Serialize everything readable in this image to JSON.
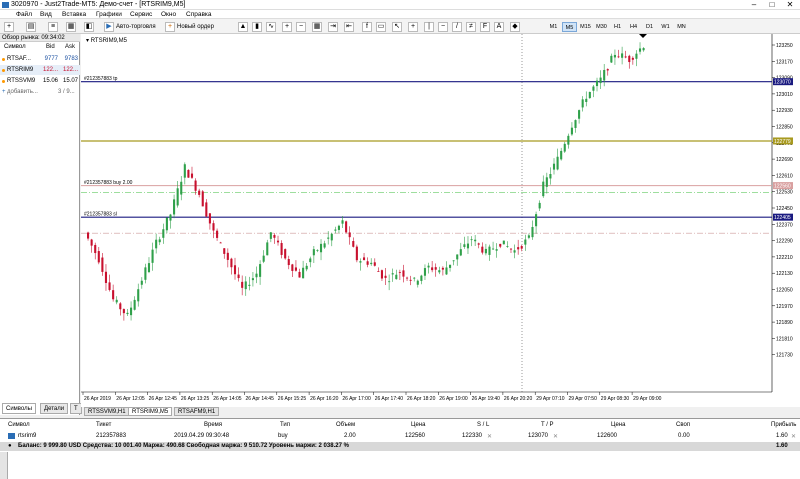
{
  "window": {
    "title": "3020970 - Just2Trade-MT5: Демо-счет - [RTSRIM9,M5]"
  },
  "menu": [
    "Файл",
    "Вид",
    "Вставка",
    "Графики",
    "Сервис",
    "Окно",
    "Справка"
  ],
  "toolbar": {
    "auto_trading": "Авто-торговля",
    "new_order": "Новый ордер",
    "timeframes": [
      "M1",
      "M5",
      "M15",
      "M30",
      "H1",
      "H4",
      "D1",
      "W1",
      "MN"
    ],
    "selected_timeframe": "M5"
  },
  "market_watch": {
    "header": "Обзор рынка: 09:34:02",
    "columns": [
      "Символ",
      "Bid",
      "Ask"
    ],
    "rows": [
      {
        "symbol": "RTSAF...",
        "bid": "9777",
        "ask": "9783"
      },
      {
        "symbol": "RTSRIM9",
        "bid": "122...",
        "ask": "122..."
      },
      {
        "symbol": "RTSSVM9",
        "bid": "15.06",
        "ask": "15.07"
      }
    ],
    "add_label": "добавить...",
    "count": "3 / 9...",
    "tabs": [
      "Символы",
      "Детали",
      "Т"
    ]
  },
  "chart": {
    "label": "RTSRIM9,M5",
    "line_labels": {
      "tp": "#212357883 tp",
      "buy": "#212357883 buy 2.00",
      "sl": "#212357883 sl"
    },
    "price_ticks": [
      "123250",
      "123170",
      "123090",
      "123010",
      "122930",
      "122850",
      "122770",
      "122690",
      "122610",
      "122530",
      "122450",
      "122370",
      "122290",
      "122210",
      "122130",
      "122050",
      "121970",
      "121890",
      "121810",
      "121730"
    ],
    "price_badges": {
      "tp": "123070",
      "gold": "122779",
      "buy": "122560",
      "sl": "122405"
    },
    "time_ticks": [
      "26 Apr 2019",
      "26 Apr 12:05",
      "26 Apr 12:45",
      "26 Apr 13:25",
      "26 Apr 14:05",
      "26 Apr 14:45",
      "26 Apr 15:25",
      "26 Apr 16:20",
      "26 Apr 17:00",
      "26 Apr 17:40",
      "26 Apr 18:20",
      "26 Apr 19:00",
      "26 Apr 19:40",
      "26 Apr 20:20",
      "29 Apr 07:10",
      "29 Apr 07:50",
      "29 Apr 08:30",
      "29 Apr 09:00"
    ],
    "tabs": [
      "RTSSVM9,H1",
      "RTSRIM9,M5",
      "RTSAFM9,H1"
    ],
    "selected_tab": "RTSRIM9,M5"
  },
  "terminal": {
    "columns": [
      "Символ",
      "Тикет",
      "Время",
      "Тип",
      "Объем",
      "Цена",
      "S / L",
      "T / P",
      "Цена",
      "Своп",
      "Прибыль"
    ],
    "row": [
      "rtsrim9",
      "212357883",
      "2019.04.29 09:30:48",
      "buy",
      "2.00",
      "122560",
      "122330",
      "123070",
      "122600",
      "0.00",
      "1.60"
    ],
    "balance": "Баланс: 9 999.80 USD  Средства: 10 001.40  Маржа: 490.68  Свободная маржа: 9 510.72  Уровень маржи: 2 038.27 %",
    "balance_profit": "1.60"
  },
  "colors": {
    "tp_line": "#1a1a80",
    "gold_line": "#a89a20",
    "buy_line": "#d9a0a0",
    "sl_line": "#1a1a80",
    "bull": "#2fa04a",
    "bear": "#c8102e"
  }
}
